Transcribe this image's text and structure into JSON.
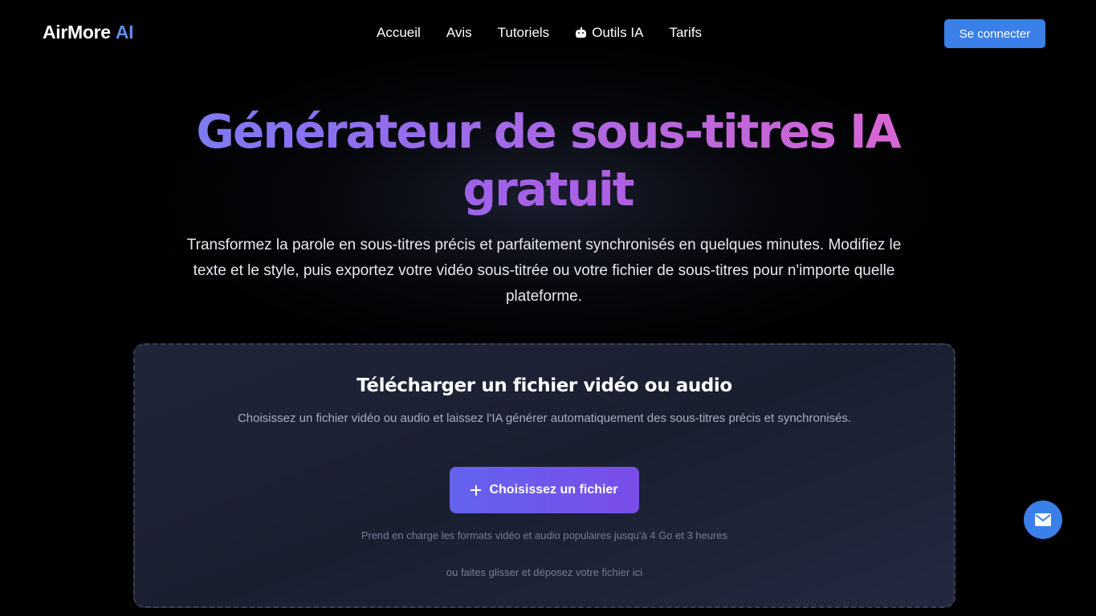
{
  "header": {
    "logo_text": "AirMore",
    "logo_accent": "AI",
    "nav": [
      {
        "label": "Accueil"
      },
      {
        "label": "Avis"
      },
      {
        "label": "Tutoriels"
      },
      {
        "label": "Outils IA",
        "icon": "robot-icon"
      },
      {
        "label": "Tarifs"
      }
    ],
    "login_label": "Se connecter"
  },
  "hero": {
    "title_line1": "Générateur de sous-titres IA",
    "title_line2": "gratuit",
    "subtitle": "Transformez la parole en sous-titres précis et parfaitement synchronisés en quelques minutes. Modifiez le texte et le style, puis exportez votre vidéo sous-titrée ou votre fichier de sous-titres pour n'importe quelle plateforme."
  },
  "upload": {
    "title": "Télécharger un fichier vidéo ou audio",
    "description": "Choisissez un fichier vidéo ou audio et laissez l'IA générer automatiquement des sous-titres précis et synchronisés.",
    "button_label": "Choisissez un fichier",
    "button_icon": "plus-icon",
    "support_text": "Prend en charge les formats vidéo et audio populaires jusqu'à 4 Go et 3 heures",
    "drop_text": "ou faites glisser et déposez votre fichier ici"
  },
  "fab": {
    "icon": "mail-icon"
  },
  "colors": {
    "accent_blue": "#3b7fe8",
    "button_gradient_start": "#6363f0",
    "button_gradient_end": "#7a4de8",
    "title_gradient_start": "#6d8cf5",
    "title_gradient_end": "#e46bcf"
  }
}
